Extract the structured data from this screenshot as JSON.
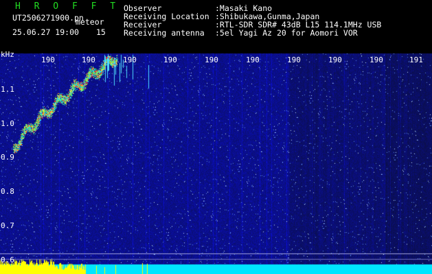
{
  "app": {
    "logo": "H R O F F T"
  },
  "info": {
    "filename": "UT2506271900.pn",
    "category": "meteor",
    "datetime": "25.06.27 19:00",
    "interval": "15",
    "fields": [
      {
        "label": "Observer",
        "value": ":Masaki Kano"
      },
      {
        "label": "Receiving Location",
        "value": ":Shibukawa,Gunma,Japan"
      },
      {
        "label": "Receiver",
        "value": ":RTL-SDR SDR# 43dB L15 114.1MHz USB"
      },
      {
        "label": "Receiving antenna",
        "value": ":5el Yagi Az 20 for Aomori VOR"
      }
    ]
  },
  "axes": {
    "y_unit": "kHz",
    "y_ticks": [
      "1.1",
      "1.0",
      "0.9",
      "0.8",
      "0.7",
      "0.6"
    ],
    "x_ticks": [
      "190",
      "190",
      "190",
      "190",
      "190",
      "190",
      "190",
      "190",
      "190",
      "191"
    ]
  },
  "colors": {
    "background": "#000000",
    "noise_floor": "#14148c",
    "logo": "#22dd22",
    "power_bar": "#ffff00",
    "baseline_bar": "#00e5ff"
  }
}
